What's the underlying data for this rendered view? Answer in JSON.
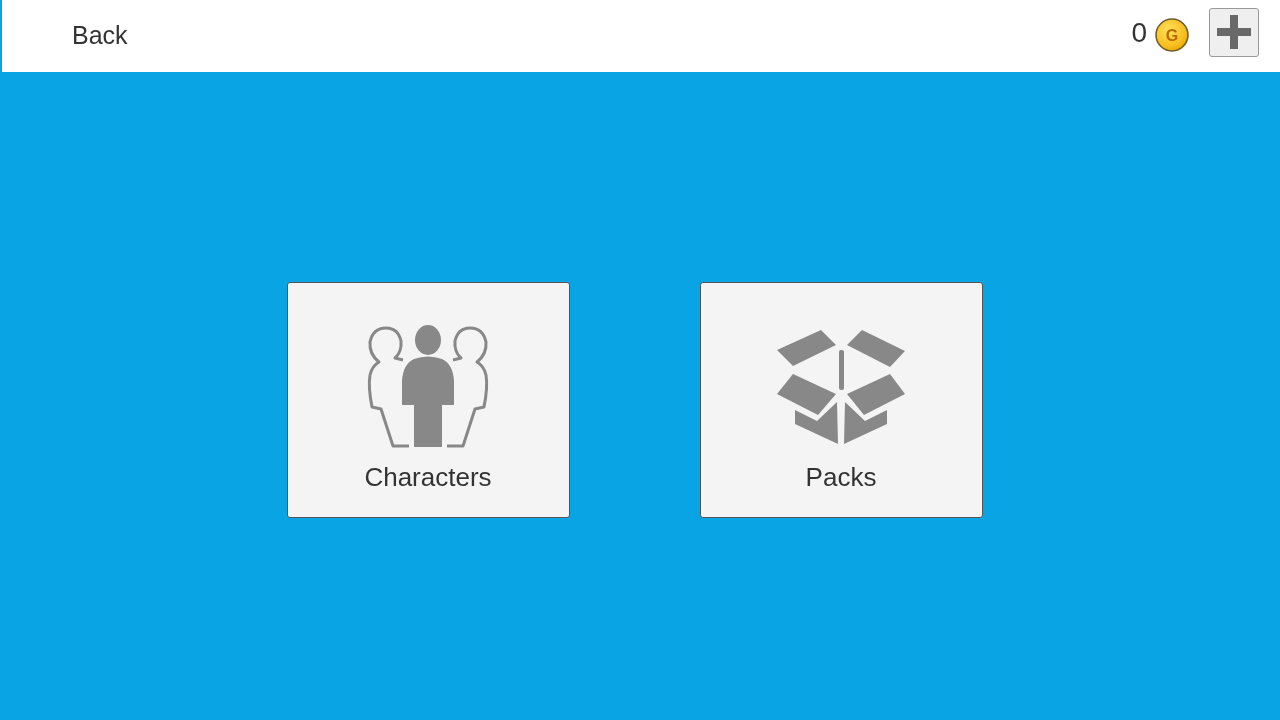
{
  "header": {
    "back_label": "Back",
    "coins": "0",
    "coin_letter": "G"
  },
  "menu_tiles": [
    {
      "kind": "characters",
      "label": "Characters"
    },
    {
      "kind": "packs",
      "label": "Packs"
    }
  ]
}
